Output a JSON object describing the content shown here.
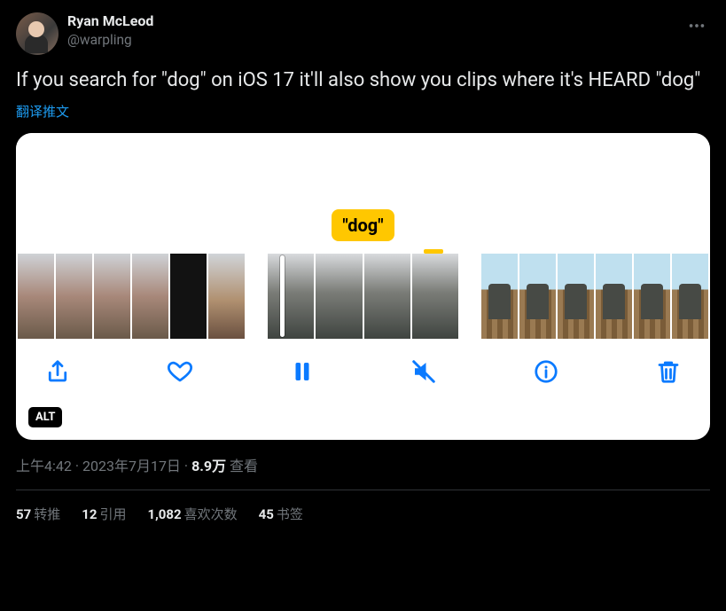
{
  "author": {
    "display_name": "Ryan McLeod",
    "handle": "@warpling"
  },
  "tweet_text": "If you search for \"dog\" on iOS 17 it'll also show you clips where it's HEARD \"dog\"",
  "translate_label": "翻译推文",
  "media": {
    "tag_label": "\"dog\"",
    "alt_badge": "ALT",
    "toolbar": {
      "share": "share",
      "like": "like",
      "pause": "pause",
      "mute": "mute",
      "info": "info",
      "trash": "trash"
    }
  },
  "meta": {
    "time": "上午4:42",
    "date": "2023年7月17日",
    "separator": " · ",
    "views_count": "8.9万",
    "views_label": "查看"
  },
  "stats": {
    "retweets": {
      "count": "57",
      "label": "转推"
    },
    "quotes": {
      "count": "12",
      "label": "引用"
    },
    "likes": {
      "count": "1,082",
      "label": "喜欢次数"
    },
    "bookmarks": {
      "count": "45",
      "label": "书签"
    }
  }
}
